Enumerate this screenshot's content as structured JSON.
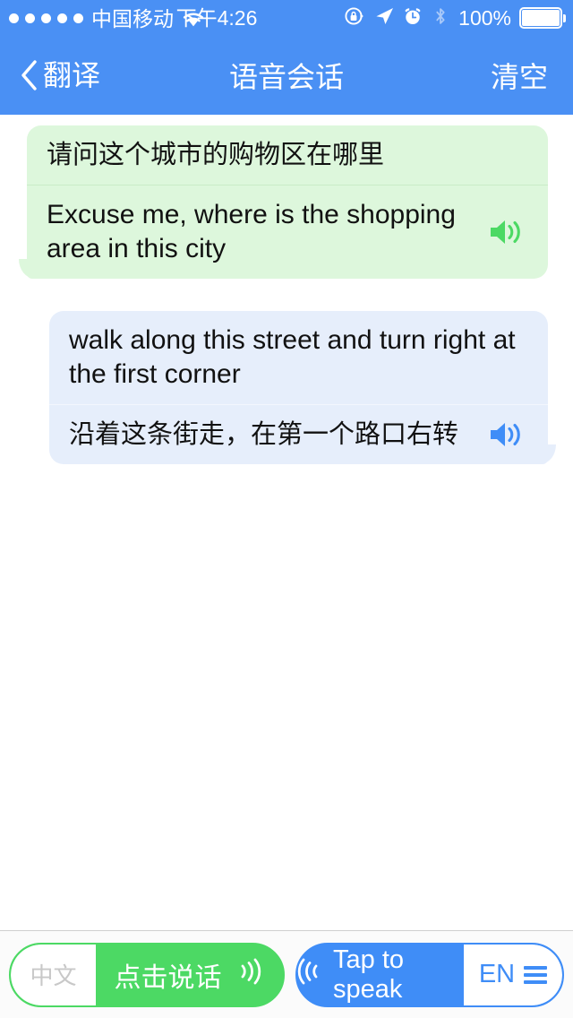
{
  "status_bar": {
    "signal_dots": 5,
    "carrier": "中国移动",
    "wifi_icon": "wifi-icon",
    "time": "下午4:26",
    "rotation_lock_icon": "rotation-lock-icon",
    "location_icon": "location-arrow-icon",
    "alarm_icon": "alarm-clock-icon",
    "bluetooth_icon": "bluetooth-icon",
    "battery_percent": "100%",
    "battery_icon": "battery-full-icon",
    "bar_color": "#4a90f4"
  },
  "nav_bar": {
    "back_icon": "chevron-left-icon",
    "back_label": "翻译",
    "title": "语音会话",
    "action_label": "清空",
    "bar_color": "#4a90f4"
  },
  "conversation": {
    "messages": [
      {
        "side": "left",
        "bubble_color": "#ddf7dc",
        "speaker_icon": "speaker-icon",
        "speaker_color": "#4cd964",
        "source_text": "请问这个城市的购物区在哪里",
        "translated_text": "Excuse me, where is the shopping area in this city"
      },
      {
        "side": "right",
        "bubble_color": "#e6eefb",
        "speaker_icon": "speaker-icon",
        "speaker_color": "#3f8df7",
        "source_text": "walk along this street and turn right at the first corner",
        "translated_text": "沿着这条街走，在第一个路口右转"
      }
    ]
  },
  "toolbar": {
    "left_control": {
      "language_label": "中文",
      "speak_label": "点击说话",
      "wave_icon": "sound-wave-right-icon",
      "accent_color": "#4cd964"
    },
    "right_control": {
      "wave_icon": "sound-wave-left-icon",
      "speak_label": "Tap to speak",
      "language_label": "EN",
      "menu_icon": "hamburger-menu-icon",
      "accent_color": "#3f8df7"
    }
  }
}
